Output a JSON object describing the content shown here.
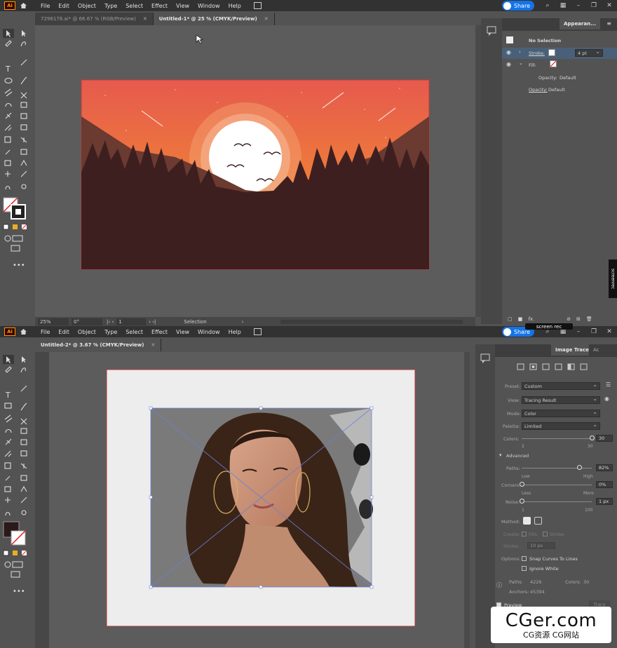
{
  "app": {
    "logo": "Ai",
    "share": "Share"
  },
  "menus": [
    "File",
    "Edit",
    "Object",
    "Type",
    "Select",
    "Effect",
    "View",
    "Window",
    "Help"
  ],
  "top": {
    "tabs": [
      {
        "label": "7296178.ai* @ 66.67 % (RGB/Preview)"
      },
      {
        "label": "Untitled-1* @ 25 % (CMYK/Preview)"
      }
    ],
    "status": {
      "zoom": "25%",
      "rotate": "0°",
      "artboard": "1",
      "tool": "Selection"
    },
    "appearance": {
      "tab": "Appearan...",
      "title": "No Selection",
      "stroke_label": "Stroke:",
      "stroke_value": "4 pt",
      "fill_label": "Fill:",
      "opacity1": "Opacity:",
      "opacity1_val": "Default",
      "opacity2": "Opacity:",
      "opacity2_val": "Default",
      "fx": "fx."
    }
  },
  "bottom": {
    "tabs": [
      {
        "label": "Untitled-2* @ 3.67 % (CMYK/Preview)"
      }
    ],
    "trace": {
      "tab": "Image Trace",
      "tab2": "Ac",
      "preset_label": "Preset:",
      "preset": "Custom",
      "view_label": "View:",
      "view": "Tracing Result",
      "mode_label": "Mode:",
      "mode": "Color",
      "palette_label": "Palette:",
      "palette": "Limited",
      "colors_label": "Colors:",
      "colors_val": "30",
      "colors_min": "2",
      "colors_max": "30",
      "colors_pos": 1.0,
      "advanced": "Advanced",
      "paths_label": "Paths:",
      "paths_val": "82%",
      "paths_low": "Low",
      "paths_high": "High",
      "paths_pos": 0.82,
      "corners_label": "Corners:",
      "corners_val": "0%",
      "corners_less": "Less",
      "corners_more": "More",
      "corners_pos": 0.0,
      "noise_label": "Noise:",
      "noise_val": "1 px",
      "noise_min": "1",
      "noise_max": "100",
      "noise_pos": 0.0,
      "method_label": "Method:",
      "create_label": "Create:",
      "fills": "Fills",
      "stroke": "Stroke",
      "stroke_label": "Stroke:",
      "stroke_val": "10 px",
      "options_label": "Options:",
      "snap": "Snap Curves To Lines",
      "ignore": "Ignore White",
      "paths_info_label": "Paths:",
      "paths_info": "4226",
      "colors_info_label": "Colors:",
      "colors_info": "30",
      "anchors_label": "Anchors:",
      "anchors_info": "45394",
      "preview": "Preview",
      "trace_btn": "Trace"
    }
  },
  "overlays": {
    "screenrec": "screenrec",
    "screenrec2": "screen rec",
    "watermark": "CGer.com",
    "watermark_sub": "CG资源 CG网站"
  },
  "colors": {
    "accent": "#1473e6",
    "sky_top": "#e65a4e",
    "sky_bottom": "#f08a30",
    "ground": "#3e1f20",
    "sun": "#ffffff"
  }
}
